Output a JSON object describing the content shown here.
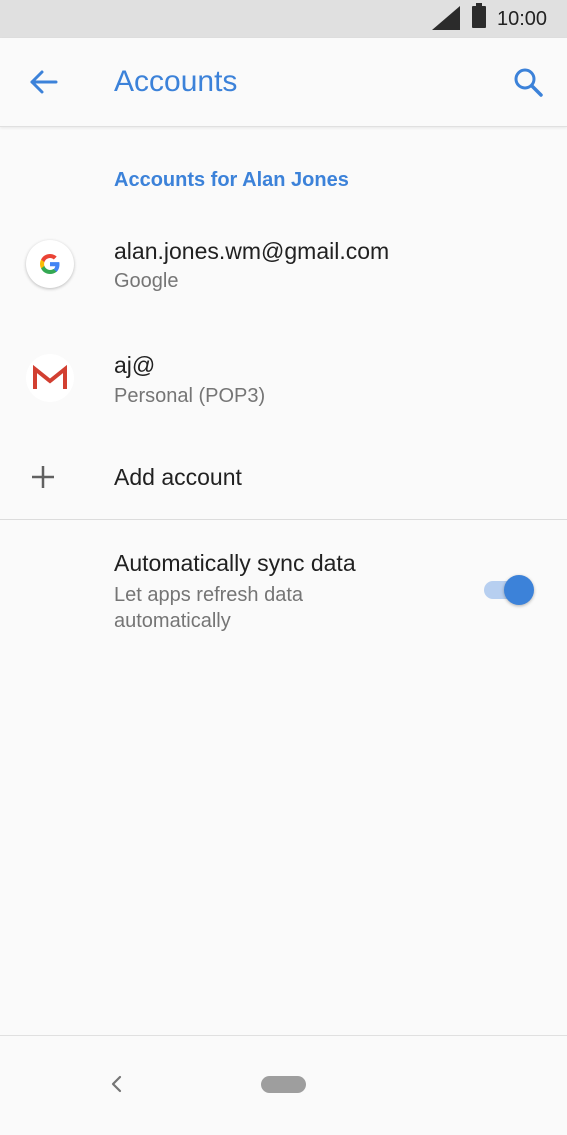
{
  "status_bar": {
    "time": "10:00"
  },
  "app_bar": {
    "title": "Accounts",
    "back_icon": "arrow-back-icon",
    "search_icon": "search-icon"
  },
  "section": {
    "header": "Accounts for Alan Jones"
  },
  "accounts": [
    {
      "primary": "alan.jones.wm@gmail.com",
      "secondary": "Google",
      "icon": "google-logo-icon"
    },
    {
      "primary": "aj@",
      "secondary": "Personal (POP3)",
      "icon": "gmail-logo-icon"
    }
  ],
  "add_account": {
    "label": "Add account",
    "icon": "plus-icon"
  },
  "sync": {
    "title": "Automatically sync data",
    "summary": "Let apps refresh data automatically",
    "enabled": true
  },
  "navigation": {
    "back_icon": "nav-back-icon",
    "home_icon": "nav-home-pill-icon"
  },
  "colors": {
    "accent": "#3c82d9",
    "toggle_track": "#b7cff0",
    "status_bar": "#e0e0e0",
    "background": "#fafafa"
  }
}
